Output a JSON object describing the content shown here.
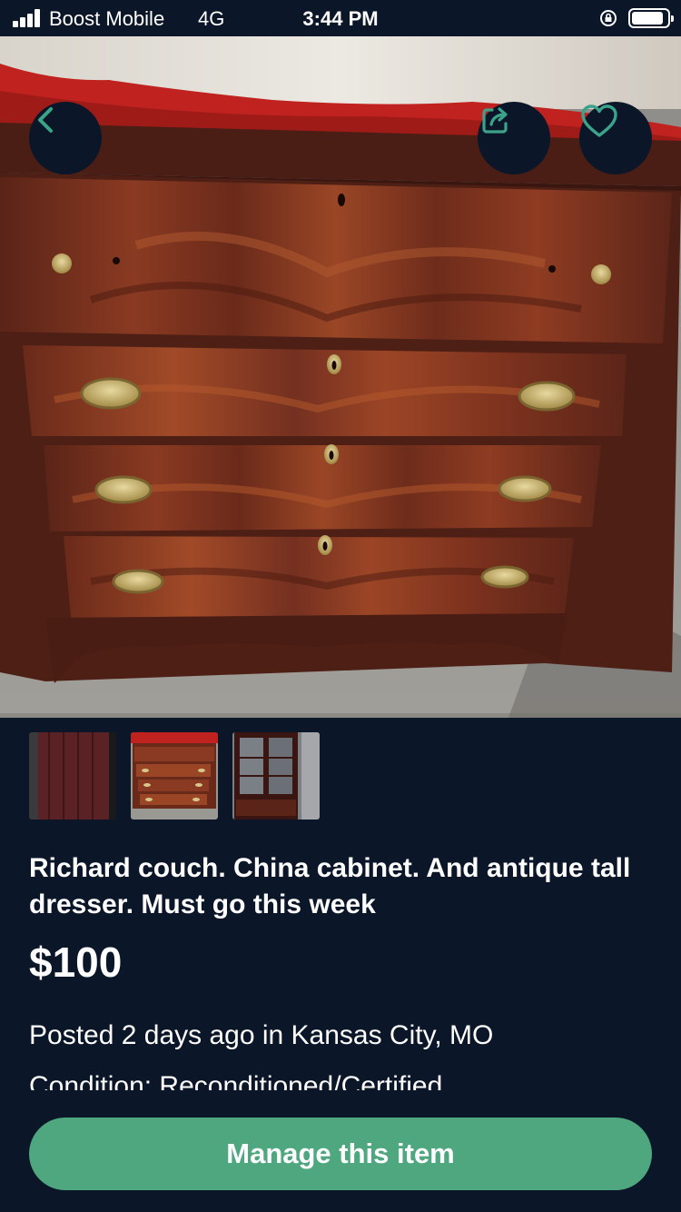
{
  "status_bar": {
    "carrier": "Boost Mobile",
    "network": "4G",
    "time": "3:44 PM",
    "battery_level": 0.9,
    "signal_bars": 4
  },
  "hero": {
    "image_subject": "antique mahogany dresser with brass oval pulls",
    "back_icon": "chevron-left-icon",
    "share_icon": "share-icon",
    "favorite_icon": "heart-icon"
  },
  "thumbnails": [
    {
      "subject": "couch upholstery"
    },
    {
      "subject": "antique dresser"
    },
    {
      "subject": "china cabinet"
    }
  ],
  "listing": {
    "title": "Richard couch. China cabinet. And antique tall dresser. Must go this week",
    "price": "$100",
    "posted": "Posted 2 days ago in Kansas City, MO",
    "condition": "Condition: Reconditioned/Certified"
  },
  "action": {
    "manage_label": "Manage this item"
  },
  "colors": {
    "background": "#0b1629",
    "accent": "#4ea77f",
    "icon_teal": "#3aa38a"
  }
}
